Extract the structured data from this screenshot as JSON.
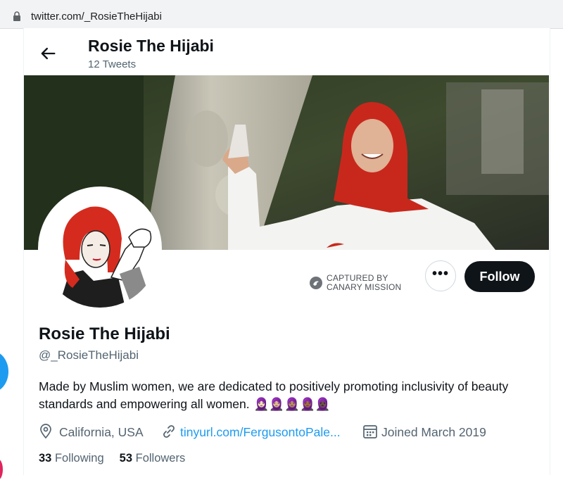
{
  "browser": {
    "url": "twitter.com/_RosieTheHijabi"
  },
  "header": {
    "title": "Rosie The Hijabi",
    "tweet_count": "12 Tweets"
  },
  "watermark": {
    "line1": "CAPTURED BY",
    "line2": "CANARY MISSION"
  },
  "actions": {
    "more": "•••",
    "follow": "Follow"
  },
  "profile": {
    "name": "Rosie The Hijabi",
    "handle": "@_RosieTheHijabi",
    "bio": "Made by Muslim women, we are dedicated to positively promoting inclusivity of beauty standards and empowering all women.",
    "bio_emojis": "🧕🏻🧕🏼🧕🏽🧕🏾🧕🏿",
    "location": "California, USA",
    "link": "tinyurl.com/FergusontoPale...",
    "joined": "Joined March 2019"
  },
  "stats": {
    "following_count": "33",
    "following_label": "Following",
    "followers_count": "53",
    "followers_label": "Followers"
  },
  "colors": {
    "accent": "#1d9bf0",
    "follow_bg": "#0f1419",
    "secondary_text": "#536471"
  },
  "icons": [
    "lock-icon",
    "back-arrow-icon",
    "canary-icon",
    "more-icon",
    "location-icon",
    "link-icon",
    "calendar-icon"
  ]
}
